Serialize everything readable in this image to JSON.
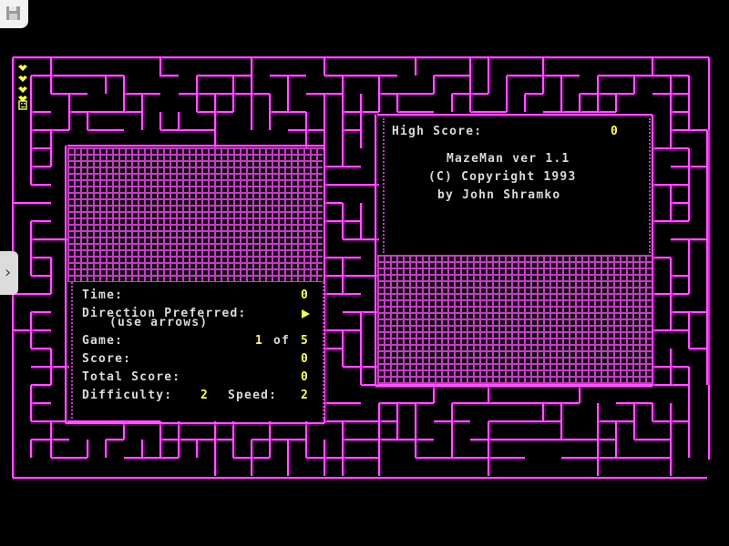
{
  "window": {
    "save_icon": "floppy-disk-icon",
    "side_toggle_icon": "chevron-right-icon",
    "side_toggle_glyph": "›"
  },
  "status": {
    "lives_icon": "heart-icon",
    "lives_count": 4,
    "player_icon": "smiley-face-icon"
  },
  "info": {
    "high_score_label": "High Score:",
    "high_score": "0",
    "title": "MazeMan ver 1.1",
    "copyright": "(C) Copyright 1993",
    "author": "by John Shramko"
  },
  "stats": {
    "time_label": "Time:",
    "time": "0",
    "direction_label": "Direction Preferred:",
    "direction_hint": "(use arrows)",
    "direction_icon": "right-arrow-icon",
    "game_label": "Game:",
    "game_current": "1",
    "game_of": "of",
    "game_total": "5",
    "score_label": "Score:",
    "score": "0",
    "total_label": "Total Score:",
    "total": "0",
    "difficulty_label": "Difficulty:",
    "difficulty": "2",
    "speed_label": "Speed:",
    "speed": "2"
  },
  "colors": {
    "background": "#000000",
    "maze_wall": "#ff55ff",
    "wall_shadow": "#aa00aa",
    "text": "#d9d9d9",
    "value": "#ffff55"
  }
}
